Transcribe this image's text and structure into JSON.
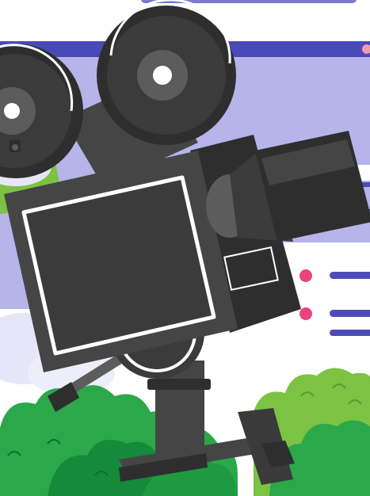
{
  "illustration": {
    "subject": "vintage-film-camera-icon",
    "colors": {
      "background": "#ffffff",
      "ui_bar": "#4a49b8",
      "ui_panel": "#b6b4e8",
      "card": "#ffffff",
      "card_line": "#4d4bb8",
      "bullet": "#e8457d",
      "bush_light": "#7cc243",
      "bush_dark": "#2aa84a",
      "camera_dark": "#2e2e2e",
      "camera_mid": "#454545",
      "camera_light": "#5c5c5c",
      "cloud": "#e7e6f8"
    }
  }
}
